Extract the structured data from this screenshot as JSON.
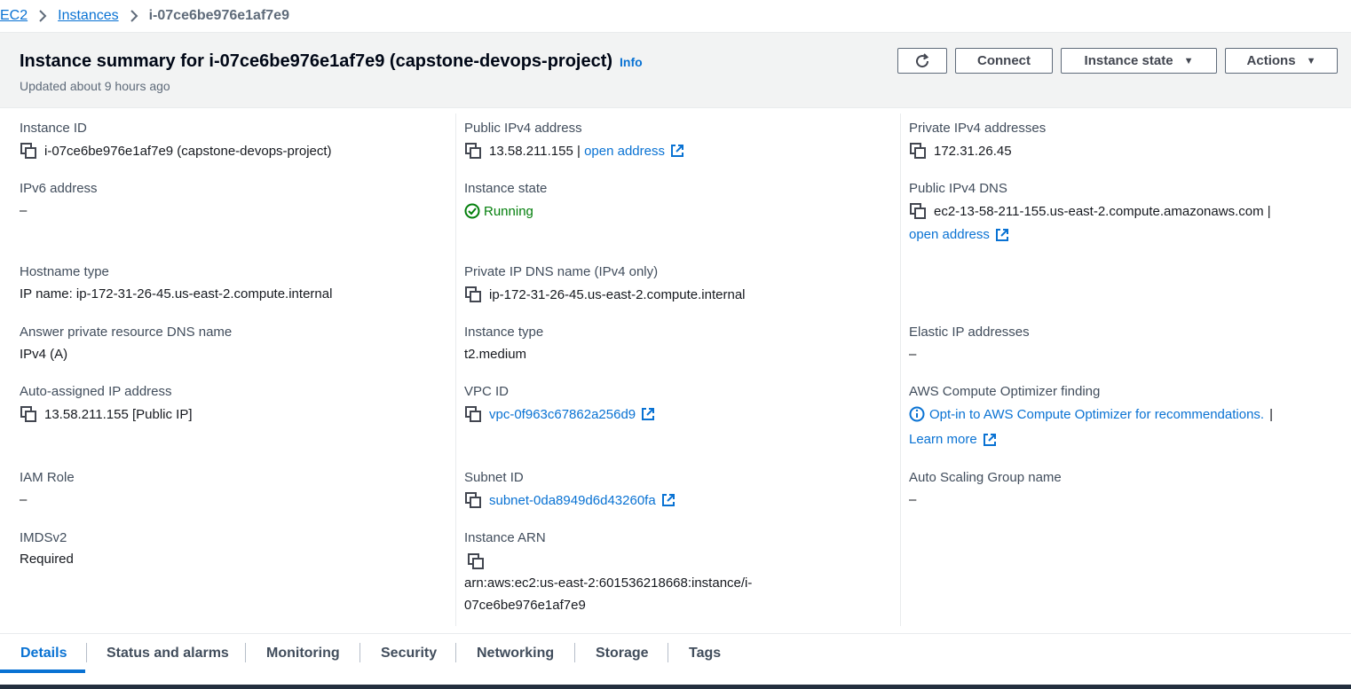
{
  "breadcrumb": {
    "items": [
      "EC2",
      "Instances"
    ],
    "current": "i-07ce6be976e1af7e9"
  },
  "header": {
    "title": "Instance summary for i-07ce6be976e1af7e9 (capstone-devops-project)",
    "info": "Info",
    "updated": "Updated about 9 hours ago",
    "buttons": {
      "connect": "Connect",
      "instance_state": "Instance state",
      "actions": "Actions"
    }
  },
  "details": {
    "instance_id": {
      "label": "Instance ID",
      "value": "i-07ce6be976e1af7e9 (capstone-devops-project)"
    },
    "public_ipv4": {
      "label": "Public IPv4 address",
      "value": "13.58.211.155 |",
      "link": "open address"
    },
    "private_ipv4": {
      "label": "Private IPv4 addresses",
      "value": "172.31.26.45"
    },
    "ipv6": {
      "label": "IPv6 address",
      "value": "–"
    },
    "instance_state": {
      "label": "Instance state",
      "value": "Running"
    },
    "public_dns": {
      "label": "Public IPv4 DNS",
      "value": "ec2-13-58-211-155.us-east-2.compute.amazonaws.com |",
      "link": "open address"
    },
    "hostname_type": {
      "label": "Hostname type",
      "value": "IP name: ip-172-31-26-45.us-east-2.compute.internal"
    },
    "private_dns": {
      "label": "Private IP DNS name (IPv4 only)",
      "value": "ip-172-31-26-45.us-east-2.compute.internal"
    },
    "answer_dns": {
      "label": "Answer private resource DNS name",
      "value": "IPv4 (A)"
    },
    "instance_type": {
      "label": "Instance type",
      "value": "t2.medium"
    },
    "elastic_ip": {
      "label": "Elastic IP addresses",
      "value": "–"
    },
    "auto_ip": {
      "label": "Auto-assigned IP address",
      "value": "13.58.211.155 [Public IP]"
    },
    "vpc_id": {
      "label": "VPC ID",
      "value": "vpc-0f963c67862a256d9"
    },
    "optimizer": {
      "label": "AWS Compute Optimizer finding",
      "value": "Opt-in to AWS Compute Optimizer for recommendations.",
      "sep": "|",
      "link": "Learn more"
    },
    "iam_role": {
      "label": "IAM Role",
      "value": "–"
    },
    "subnet_id": {
      "label": "Subnet ID",
      "value": "subnet-0da8949d6d43260fa"
    },
    "asg_name": {
      "label": "Auto Scaling Group name",
      "value": "–"
    },
    "imdsv2": {
      "label": "IMDSv2",
      "value": "Required"
    },
    "instance_arn": {
      "label": "Instance ARN",
      "line1": "arn:aws:ec2:us-east-2:601536218668:instance/i-",
      "line2": "07ce6be976e1af7e9"
    }
  },
  "tabs": [
    "Details",
    "Status and alarms",
    "Monitoring",
    "Security",
    "Networking",
    "Storage",
    "Tags"
  ],
  "colors": {
    "link": "#0972d3",
    "running": "#037f0c",
    "header_bg": "#f2f3f3"
  }
}
